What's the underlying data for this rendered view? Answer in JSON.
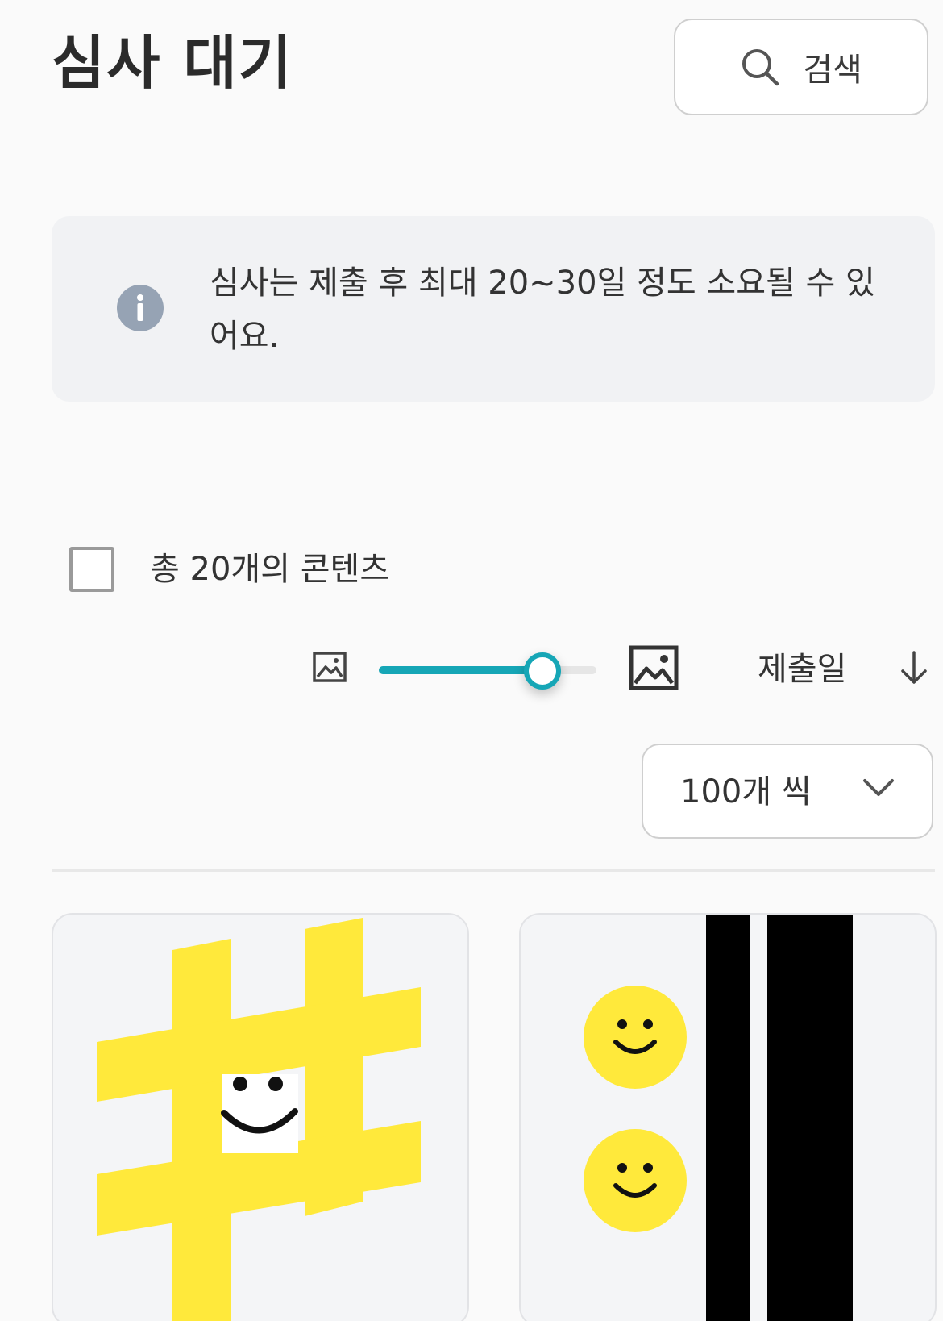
{
  "header": {
    "title": "심사 대기",
    "search_label": "검색",
    "search_icon": "search-icon"
  },
  "notice": {
    "icon": "info-icon",
    "text": "심사는 제출 후 최대 20~30일 정도 소요될 수 있어요."
  },
  "list": {
    "count_label": "총 20개의 콘텐츠",
    "select_all_checked": false
  },
  "toolbar": {
    "thumbnail_size_min_icon": "image-small-icon",
    "thumbnail_size_max_icon": "image-large-icon",
    "thumbnail_size_level": 0.75,
    "sort_label": "제출일",
    "sort_direction_icon": "arrow-down-icon",
    "page_size_value": "100개 씩",
    "page_size_icon": "chevron-down-icon"
  },
  "colors": {
    "accent": "#16a6b6",
    "info_icon": "#96a3b4",
    "notice_bg": "#f1f2f4",
    "sticker_yellow": "#ffe93b"
  },
  "content_items": [
    {
      "thumbnail": "hashtag-smiley-sticker"
    },
    {
      "thumbnail": "smiley-faces-black-stripes-sticker"
    }
  ]
}
